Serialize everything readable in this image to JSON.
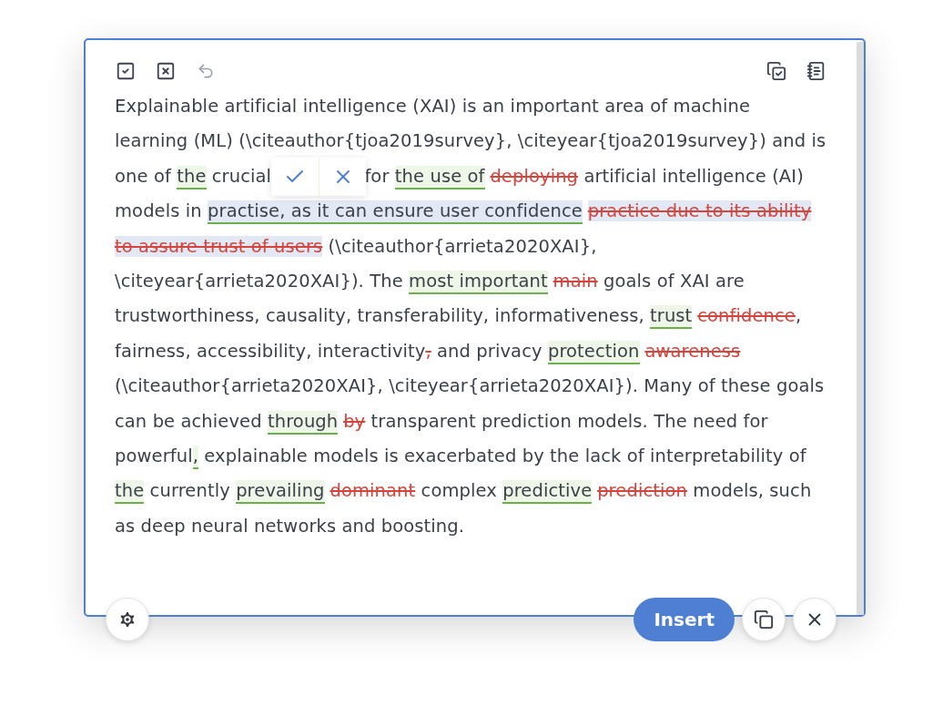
{
  "toolbar": {
    "undo_disabled": true
  },
  "segments": [
    {
      "kind": "plain",
      "text": "Explainable artificial intelligence (XAI) is an important area of machine learning (ML) (\\citeauthor{tjoa2019survey}, \\citeyear{tjoa2019survey}) and is one of ",
      "selected": false
    },
    {
      "kind": "insert",
      "text": "the",
      "selected": false
    },
    {
      "kind": "plain",
      "text": " crucial",
      "selected": false
    },
    {
      "kind": "popover"
    },
    {
      "kind": "plain",
      "text": " for ",
      "selected": false
    },
    {
      "kind": "insert",
      "text": "the use of",
      "selected": false
    },
    {
      "kind": "delete",
      "text": "deploying",
      "selected": false
    },
    {
      "kind": "plain",
      "text": " artificial intelligence (AI) models in ",
      "selected": false
    },
    {
      "kind": "insert",
      "text": "practise, as it can ensure user confidence",
      "selected": true
    },
    {
      "kind": "delete",
      "text": "practice due to its ability to assure trust of users",
      "selected": true
    },
    {
      "kind": "plain",
      "text": " (\\citeauthor{arrieta2020XAI}, \\citeyear{arrieta2020XAI}). The ",
      "selected": false
    },
    {
      "kind": "insert",
      "text": "most important",
      "selected": false
    },
    {
      "kind": "delete",
      "text": "main",
      "selected": false
    },
    {
      "kind": "plain",
      "text": " goals of XAI are trustworthiness, causality, transferability, informativeness, ",
      "selected": false
    },
    {
      "kind": "insert",
      "text": "trust",
      "selected": false
    },
    {
      "kind": "delete",
      "text": "confidence",
      "selected": false
    },
    {
      "kind": "plain",
      "text": ", fairness, accessibility, interactivity",
      "selected": false
    },
    {
      "kind": "delete",
      "text": ",",
      "selected": false
    },
    {
      "kind": "plain",
      "text": " and privacy ",
      "selected": false
    },
    {
      "kind": "insert",
      "text": "protection",
      "selected": false
    },
    {
      "kind": "delete",
      "text": "awareness",
      "selected": false
    },
    {
      "kind": "plain",
      "text": " (\\citeauthor{arrieta2020XAI}, \\citeyear{arrieta2020XAI}). Many of these goals can be achieved ",
      "selected": false
    },
    {
      "kind": "insert",
      "text": "through",
      "selected": false
    },
    {
      "kind": "delete",
      "text": "by",
      "selected": false
    },
    {
      "kind": "plain",
      "text": " transparent prediction models. The need for powerful",
      "selected": false
    },
    {
      "kind": "insert",
      "text": ",",
      "selected": false
    },
    {
      "kind": "plain",
      "text": " explainable models is exacerbated by the lack of interpretability of ",
      "selected": false
    },
    {
      "kind": "insert",
      "text": "the",
      "selected": false
    },
    {
      "kind": "plain",
      "text": " currently ",
      "selected": false
    },
    {
      "kind": "insert",
      "text": "prevailing",
      "selected": false
    },
    {
      "kind": "delete",
      "text": "dominant",
      "selected": false
    },
    {
      "kind": "plain",
      "text": " complex ",
      "selected": false
    },
    {
      "kind": "insert",
      "text": "predictive",
      "selected": false
    },
    {
      "kind": "delete",
      "text": "prediction",
      "selected": false
    },
    {
      "kind": "plain",
      "text": " models, such as deep neural networks and boosting.",
      "selected": false
    }
  ],
  "footer": {
    "insert_label": "Insert"
  }
}
